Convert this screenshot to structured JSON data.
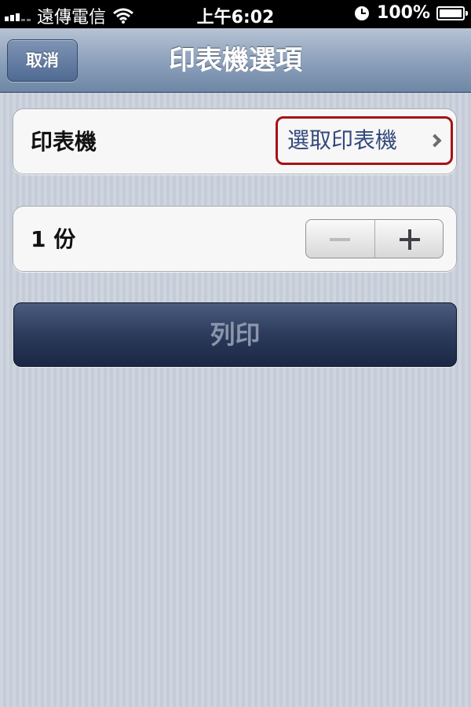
{
  "status_bar": {
    "carrier": "遠傳電信",
    "time": "上午6:02",
    "battery": "100%"
  },
  "nav": {
    "title": "印表機選項",
    "cancel_label": "取消"
  },
  "printer_row": {
    "label": "印表機",
    "value": "選取印表機"
  },
  "copies_row": {
    "label": "1 份",
    "minus": "−",
    "plus": "+"
  },
  "print_button": {
    "label": "列印"
  },
  "colors": {
    "highlight_border": "#a51217",
    "link_text": "#34497c",
    "nav_blue": "#6f86a6"
  }
}
